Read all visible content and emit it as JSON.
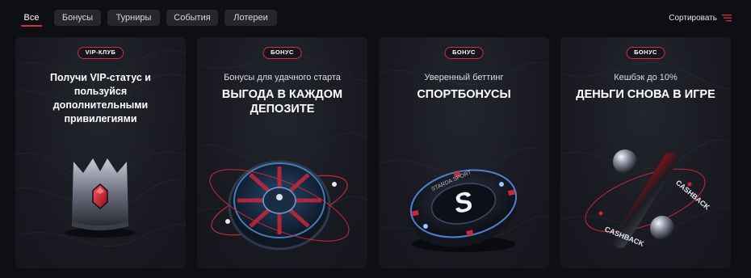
{
  "tabs": [
    {
      "label": "Все",
      "active": true
    },
    {
      "label": "Бонусы",
      "active": false
    },
    {
      "label": "Турниры",
      "active": false
    },
    {
      "label": "События",
      "active": false
    },
    {
      "label": "Лотереи",
      "active": false
    }
  ],
  "sort": {
    "label": "Сортировать",
    "icon": "sort-lines-icon"
  },
  "cards": [
    {
      "badge": "VIP-КЛУБ",
      "text": "Получи VIP-статус и пользуйся дополнительными привилегиями",
      "image": "crown-icon"
    },
    {
      "badge": "БОНУС",
      "subtitle": "Бонусы для удачного старта",
      "headline": "ВЫГОДА В КАЖДОМ ДЕПОЗИТЕ",
      "image": "roulette-icon"
    },
    {
      "badge": "БОНУС",
      "subtitle": "Уверенный беттинг",
      "headline": "СПОРТБОНУСЫ",
      "image": "sport-chip-icon",
      "chip_text": "STARDA SPORT"
    },
    {
      "badge": "БОНУС",
      "subtitle": "Кешбэк до 10%",
      "headline": "ДЕНЬГИ СНОВА В ИГРЕ",
      "image": "cashback-icon",
      "ring_text": "CASHBACK"
    }
  ],
  "colors": {
    "background": "#0e0f13",
    "accent": "#d6303c",
    "tab_bg": "#26272d",
    "card_bg": "#1a1b22"
  }
}
